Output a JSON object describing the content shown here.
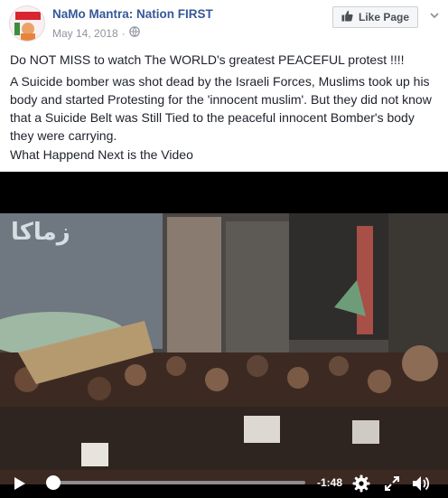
{
  "post": {
    "page_name": "NaMo Mantra: Nation FIRST",
    "date": "May 14, 2018",
    "like_label": "Like Page",
    "paragraph1": "Do NOT MISS to watch The WORLD's greatest PEACEFUL protest !!!!",
    "paragraph2": "A Suicide bomber was shot dead by the Israeli Forces, Muslims took up his body and started Protesting for the 'innocent muslim'. But they did not know that a Suicide Belt was Still Tied to the peaceful innocent Bomber's body they were carrying.",
    "paragraph3": "What Happend Next is the Video"
  },
  "video": {
    "watermark": "زماكا",
    "time_remaining": "-1:48",
    "progress": 0.0,
    "icons": [
      "play-icon",
      "settings-gear-icon",
      "fullscreen-icon",
      "volume-icon"
    ]
  },
  "colors": {
    "link_blue": "#365899",
    "meta_gray": "#90949c",
    "text": "#1d2129",
    "button_bg": "#f5f6f7"
  }
}
